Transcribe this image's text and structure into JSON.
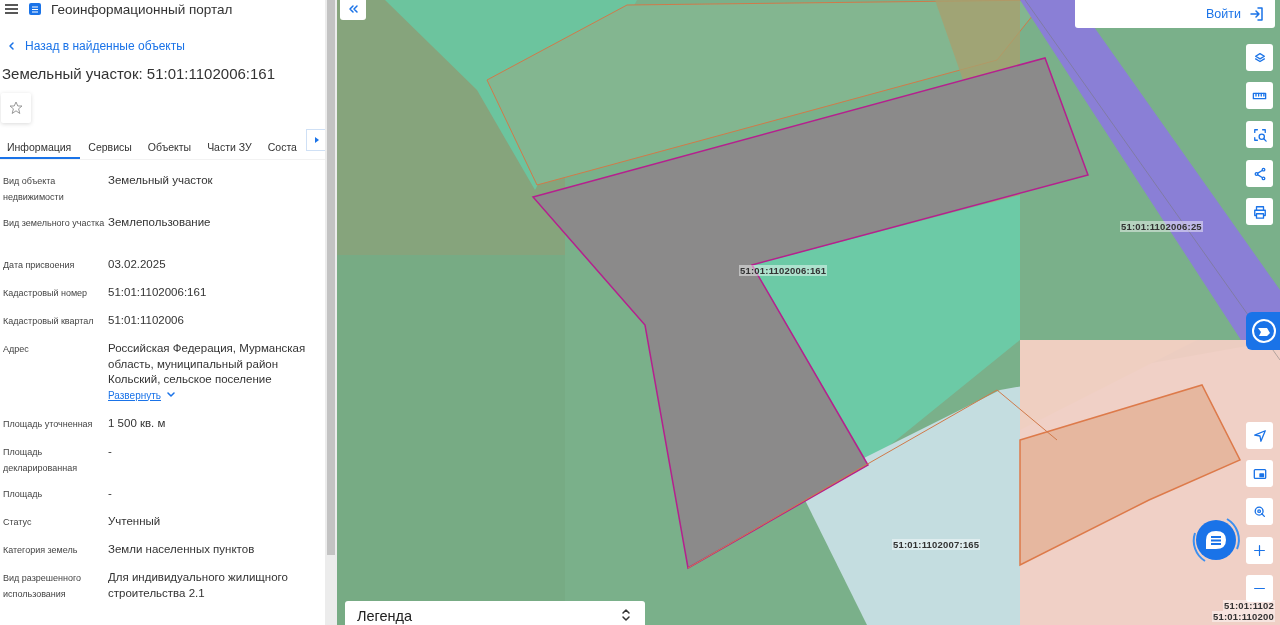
{
  "header": {
    "title": "Геоинформационный портал"
  },
  "back_link": "Назад в найденные объекты",
  "heading": "Земельный участок: 51:01:1102006:161",
  "tabs": [
    {
      "label": "Информация",
      "selected": true
    },
    {
      "label": "Сервисы",
      "selected": false
    },
    {
      "label": "Объекты",
      "selected": false
    },
    {
      "label": "Части ЗУ",
      "selected": false
    },
    {
      "label": "Соста",
      "selected": false
    }
  ],
  "fields": [
    {
      "label": "Вид объекта недвижимости",
      "value": "Земельный участок"
    },
    {
      "label": "Вид земельного участка",
      "value": "Землепользование"
    },
    {
      "label": "Дата присвоения",
      "value": "03.02.2025"
    },
    {
      "label": "Кадастровый номер",
      "value": "51:01:1102006:161"
    },
    {
      "label": "Кадастровый квартал",
      "value": "51:01:1102006"
    },
    {
      "label": "Адрес",
      "value": "Российская Федерация, Мурманская область, муниципальный район Кольский, сельское поселение",
      "link": "Развернуть"
    },
    {
      "label": "Площадь уточненная",
      "value": "1 500 кв. м"
    },
    {
      "label": "Площадь декларированная",
      "value": "-"
    },
    {
      "label": "Площадь",
      "value": "-"
    },
    {
      "label": "Статус",
      "value": "Учтенный"
    },
    {
      "label": "Категория земель",
      "value": "Земли населенных пунктов"
    },
    {
      "label": "Вид разрешенного использования",
      "value": "Для индивидуального жилищного строительства 2.1"
    }
  ],
  "map": {
    "login": "Войти",
    "legend": "Легенда",
    "parcel_labels": [
      "51:01:1102006:161",
      "51:01:1102006:25",
      "51:01:1102007:165",
      "51:01:1102",
      "51:01:110200"
    ]
  }
}
